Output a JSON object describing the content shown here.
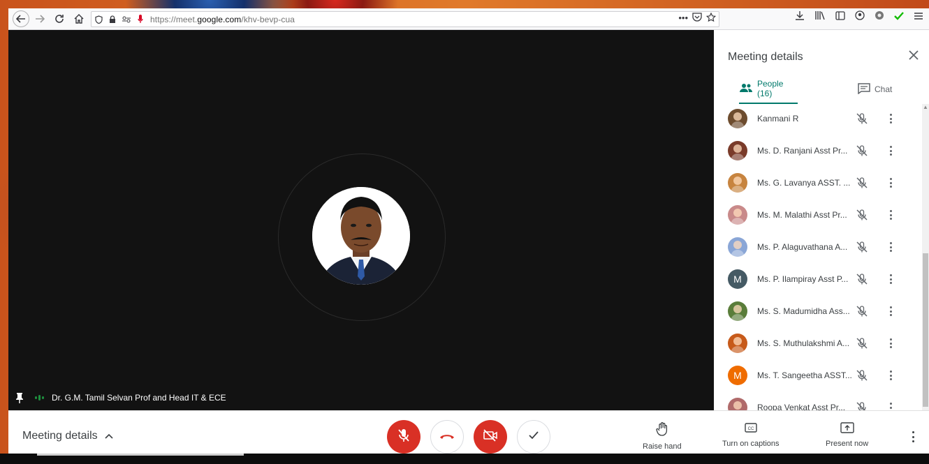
{
  "browser": {
    "url_prefix": "https://meet.",
    "url_domain": "google.com",
    "url_path": "/khv-bevp-cua"
  },
  "stage": {
    "speaker_name": "Dr. G.M. Tamil Selvan Prof and Head IT & ECE"
  },
  "panel": {
    "title": "Meeting details",
    "tabs": [
      {
        "label": "People (16)",
        "icon": "people-icon",
        "active": true
      },
      {
        "label": "Chat",
        "icon": "chat-icon",
        "active": false
      }
    ],
    "people": [
      {
        "name": "Kanmani R",
        "avatar": "photo",
        "color": "#6d4c2e"
      },
      {
        "name": "Ms. D. Ranjani Asst Pr...",
        "avatar": "photo",
        "color": "#7a3b2a"
      },
      {
        "name": "Ms. G. Lavanya ASST. ...",
        "avatar": "photo",
        "color": "#c7843f"
      },
      {
        "name": "Ms. M. Malathi Asst Pr...",
        "avatar": "photo",
        "color": "#c98a8a"
      },
      {
        "name": "Ms. P. Alaguvathana A...",
        "avatar": "photo",
        "color": "#8aa6d6"
      },
      {
        "name": "Ms. P. Ilampiray Asst P...",
        "avatar": "M",
        "color": "#455a64"
      },
      {
        "name": "Ms. S. Madumidha Ass...",
        "avatar": "photo",
        "color": "#5a7d3a"
      },
      {
        "name": "Ms. S. Muthulakshmi A...",
        "avatar": "photo",
        "color": "#c75a1a"
      },
      {
        "name": "Ms. T. Sangeetha ASST...",
        "avatar": "M",
        "color": "#ef6c00"
      },
      {
        "name": "Roopa Venkat Asst Pr...",
        "avatar": "photo",
        "color": "#b06a6a"
      }
    ]
  },
  "bottombar": {
    "details_label": "Meeting details",
    "raise_hand": "Raise hand",
    "captions": "Turn on captions",
    "present": "Present now"
  },
  "colors": {
    "accent": "#00796b",
    "danger": "#d93025",
    "stage_bg": "#121212"
  }
}
